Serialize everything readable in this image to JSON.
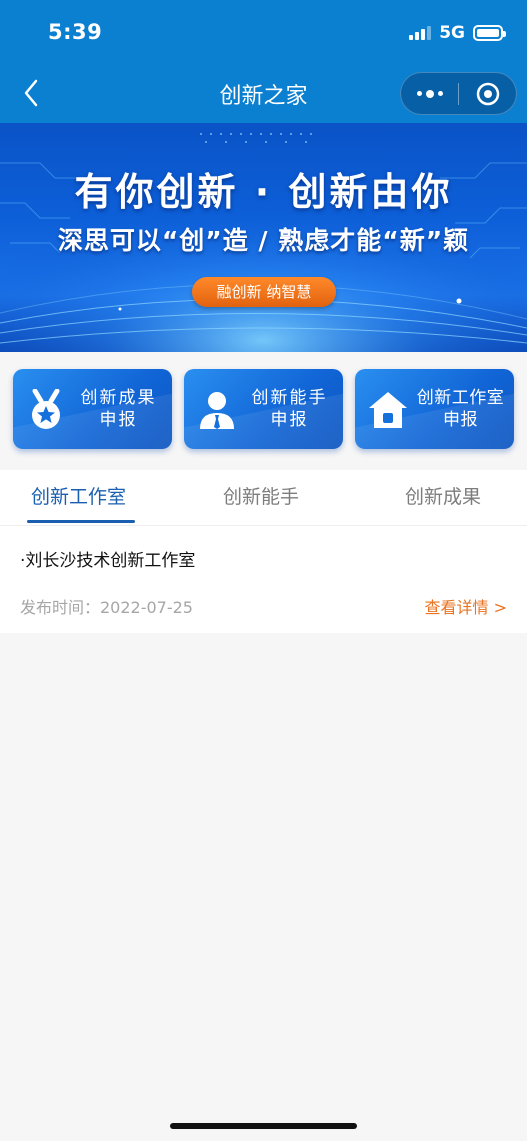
{
  "status_bar": {
    "time": "5:39",
    "network": "5G"
  },
  "nav": {
    "title": "创新之家"
  },
  "banner": {
    "title": "有你创新 · 创新由你",
    "subtitle": "深思可以“创”造 / 熟虑才能“新”颖",
    "pill": "融创新  纳智慧"
  },
  "cards": [
    {
      "icon": "medal-icon",
      "line1": "创新成果",
      "line2": "申报"
    },
    {
      "icon": "person-icon",
      "line1": "创新能手",
      "line2": "申报"
    },
    {
      "icon": "house-icon",
      "line1": "创新工作室",
      "line2": "申报"
    }
  ],
  "tabs": [
    {
      "label": "创新工作室",
      "active": true
    },
    {
      "label": "创新能手",
      "active": false
    },
    {
      "label": "创新成果",
      "active": false
    }
  ],
  "list": [
    {
      "title": "·刘长沙技术创新工作室",
      "date": "发布时间：2022-07-25",
      "link": "查看详情 >"
    }
  ],
  "colors": {
    "primary": "#0b7fd0",
    "tab_active": "#1a5fb0",
    "link": "#e87322",
    "pill": "#e2620f"
  }
}
